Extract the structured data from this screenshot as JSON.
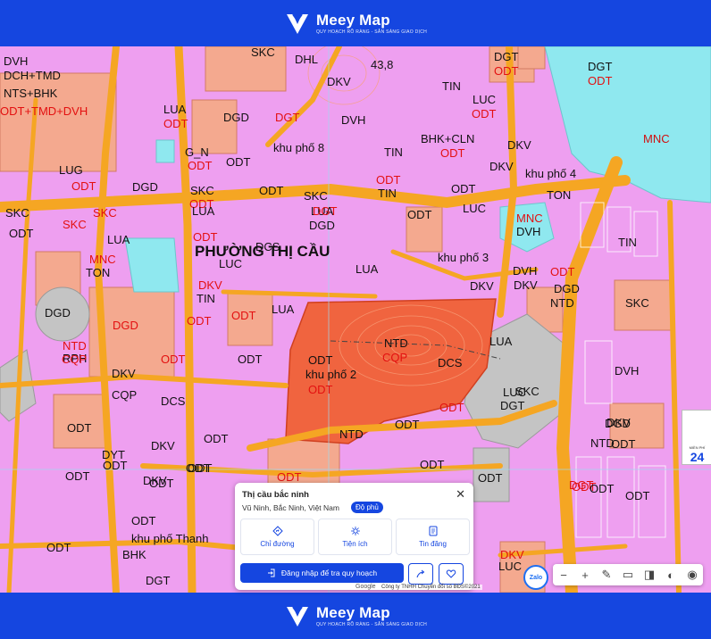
{
  "brand": {
    "name": "Meey Map",
    "tagline": "QUY HOẠCH RÕ RÀNG - SẴN SÀNG GIAO DỊCH"
  },
  "colors": {
    "brand": "#1546e0",
    "residential": "#ee9ff0",
    "road": "#f5a623",
    "rph_area": "#f0643f",
    "water": "#8fe8ef",
    "public": "#f4a98f",
    "grey": "#bdbdbd"
  },
  "map": {
    "labels": [
      {
        "text": "SKC",
        "c": "k"
      },
      {
        "text": "DHL",
        "c": "k"
      },
      {
        "text": "43,8",
        "c": "k"
      },
      {
        "text": "DGT",
        "c": "k"
      },
      {
        "text": "ODT",
        "c": "r"
      },
      {
        "text": "DGT",
        "c": "k"
      },
      {
        "text": "ODT",
        "c": "r"
      },
      {
        "text": "DVH",
        "c": "k"
      },
      {
        "text": "DCH+TMD",
        "c": "k"
      },
      {
        "text": "NTS+BHK",
        "c": "k"
      },
      {
        "text": "ODT+TMD+DVH",
        "c": "r"
      },
      {
        "text": "DKV",
        "c": "k"
      },
      {
        "text": "TIN",
        "c": "k"
      },
      {
        "text": "LUC",
        "c": "k"
      },
      {
        "text": "ODT",
        "c": "r"
      },
      {
        "text": "MNC",
        "c": "mnc"
      },
      {
        "text": "LUA",
        "c": "k"
      },
      {
        "text": "ODT",
        "c": "r"
      },
      {
        "text": "DGD",
        "c": "k"
      },
      {
        "text": "DGT",
        "c": "r"
      },
      {
        "text": "DVH",
        "c": "k"
      },
      {
        "text": "BHK+CLN",
        "c": "k"
      },
      {
        "text": "ODT",
        "c": "r"
      },
      {
        "text": "G_N",
        "c": "k"
      },
      {
        "text": "ODT",
        "c": "r"
      },
      {
        "text": "ODT",
        "c": "k"
      },
      {
        "text": "khu phố 8",
        "c": "k"
      },
      {
        "text": "TIN",
        "c": "k"
      },
      {
        "text": "DKV",
        "c": "k"
      },
      {
        "text": "LUG",
        "c": "k"
      },
      {
        "text": "ODT",
        "c": "r"
      },
      {
        "text": "DGD",
        "c": "k"
      },
      {
        "text": "SKC",
        "c": "k"
      },
      {
        "text": "ODT",
        "c": "r"
      },
      {
        "text": "ODT",
        "c": "k"
      },
      {
        "text": "SKC",
        "c": "k"
      },
      {
        "text": "LUA",
        "c": "k"
      },
      {
        "text": "ODT",
        "c": "r"
      },
      {
        "text": "TIN",
        "c": "k"
      },
      {
        "text": "DKV",
        "c": "k"
      },
      {
        "text": "khu phố 4",
        "c": "k"
      },
      {
        "text": "ODT",
        "c": "k"
      },
      {
        "text": "TON",
        "c": "k"
      },
      {
        "text": "SKC",
        "c": "k"
      },
      {
        "text": "SKC",
        "c": "r"
      },
      {
        "text": "SKC",
        "c": "r"
      },
      {
        "text": "LUA",
        "c": "k"
      },
      {
        "text": "DGT",
        "c": "r"
      },
      {
        "text": "DGD",
        "c": "k"
      },
      {
        "text": "ODT",
        "c": "k"
      },
      {
        "text": "LUC",
        "c": "k"
      },
      {
        "text": "MNC",
        "c": "r"
      },
      {
        "text": "DVH",
        "c": "k"
      },
      {
        "text": "TIN",
        "c": "k"
      },
      {
        "text": "ODT",
        "c": "k"
      },
      {
        "text": "LUA",
        "c": "k"
      },
      {
        "text": "ODT",
        "c": "r"
      },
      {
        "text": "PHƯỜNG THỊ CẦU",
        "c": "big"
      },
      {
        "text": "DCS",
        "c": "k"
      },
      {
        "text": "khu phố 3",
        "c": "k"
      },
      {
        "text": "LUA",
        "c": "k"
      },
      {
        "text": "MNC",
        "c": "r"
      },
      {
        "text": "TON",
        "c": "k"
      },
      {
        "text": "LUC",
        "c": "k"
      },
      {
        "text": "DVH",
        "c": "k"
      },
      {
        "text": "ODT",
        "c": "r"
      },
      {
        "text": "DKV",
        "c": "k"
      },
      {
        "text": "DGD",
        "c": "k"
      },
      {
        "text": "SKC",
        "c": "k"
      },
      {
        "text": "DKV",
        "c": "r"
      },
      {
        "text": "TIN",
        "c": "k"
      },
      {
        "text": "DKV",
        "c": "k"
      },
      {
        "text": "NTD",
        "c": "k"
      },
      {
        "text": "DGD",
        "c": "k"
      },
      {
        "text": "DGD",
        "c": "r"
      },
      {
        "text": "ODT",
        "c": "r"
      },
      {
        "text": "LUA",
        "c": "k"
      },
      {
        "text": "ODT",
        "c": "r"
      },
      {
        "text": "RPH",
        "c": "k"
      },
      {
        "text": "NTD",
        "c": "k"
      },
      {
        "text": "LUA",
        "c": "k"
      },
      {
        "text": "NTD",
        "c": "r"
      },
      {
        "text": "CQP",
        "c": "r"
      },
      {
        "text": "CQP",
        "c": "r"
      },
      {
        "text": "DCS",
        "c": "k"
      },
      {
        "text": "ODT",
        "c": "k"
      },
      {
        "text": "khu phố 2",
        "c": "k"
      },
      {
        "text": "ODT",
        "c": "r"
      },
      {
        "text": "ODT",
        "c": "k"
      },
      {
        "text": "DVH",
        "c": "k"
      },
      {
        "text": "DKV",
        "c": "k"
      },
      {
        "text": "CQP",
        "c": "k"
      },
      {
        "text": "ODT",
        "c": "r"
      },
      {
        "text": "LUC",
        "c": "k"
      },
      {
        "text": "SKC",
        "c": "k"
      },
      {
        "text": "DCS",
        "c": "k"
      },
      {
        "text": "ODT",
        "c": "r"
      },
      {
        "text": "DGT",
        "c": "k"
      },
      {
        "text": "DGD",
        "c": "k"
      },
      {
        "text": "ODT",
        "c": "k"
      },
      {
        "text": "ODT",
        "c": "k"
      },
      {
        "text": "DKV",
        "c": "k"
      },
      {
        "text": "ODT",
        "c": "k"
      },
      {
        "text": "ODT",
        "c": "k"
      },
      {
        "text": "ODT",
        "c": "k"
      },
      {
        "text": "ODT",
        "c": "k"
      },
      {
        "text": "ODT",
        "c": "r"
      },
      {
        "text": "DGT",
        "c": "r"
      },
      {
        "text": "DYT",
        "c": "k"
      },
      {
        "text": "ODT",
        "c": "r"
      },
      {
        "text": "ODT",
        "c": "k"
      },
      {
        "text": "NTD",
        "c": "k"
      },
      {
        "text": "ODT",
        "c": "k"
      },
      {
        "text": "ODT",
        "c": "k"
      },
      {
        "text": "ODT",
        "c": "k"
      },
      {
        "text": "DKV",
        "c": "k"
      },
      {
        "text": "ODT",
        "c": "k"
      },
      {
        "text": "ODT",
        "c": "k"
      },
      {
        "text": "ODT",
        "c": "k"
      },
      {
        "text": "ODT",
        "c": "k"
      },
      {
        "text": "ODT",
        "c": "k"
      },
      {
        "text": "khu phố Thanh",
        "c": "k"
      },
      {
        "text": "BHK",
        "c": "k"
      },
      {
        "text": "DKV",
        "c": "r"
      },
      {
        "text": "LUC",
        "c": "k"
      },
      {
        "text": "DGT",
        "c": "k"
      },
      {
        "text": "DKV",
        "c": "k"
      },
      {
        "text": "NTD",
        "c": "k"
      }
    ]
  },
  "popup": {
    "title": "Thị cầu bắc ninh",
    "address": "Vũ Ninh, Bắc Ninh, Việt Nam",
    "badge": "Độ phủ",
    "actions": [
      {
        "label": "Chỉ đường",
        "icon": "directions-icon"
      },
      {
        "label": "Tiện ích",
        "icon": "amenities-icon"
      },
      {
        "label": "Tin đăng",
        "icon": "listing-icon"
      }
    ],
    "login_label": "Đăng nhập để tra quy hoạch"
  },
  "zalo": "Zalo",
  "toolbar": [
    {
      "symbol": "−",
      "icon": "zoom-out-icon"
    },
    {
      "symbol": "+",
      "icon": "zoom-in-icon"
    },
    {
      "symbol": "✎",
      "icon": "draw-icon"
    },
    {
      "symbol": "▭",
      "icon": "layer-icon"
    },
    {
      "symbol": "◨",
      "icon": "split-icon"
    },
    {
      "symbol": "◐",
      "icon": "opacity-icon"
    },
    {
      "symbol": "◉",
      "icon": "locate-icon"
    }
  ],
  "attribution": {
    "google": "Google",
    "copyright": "Công ty TNHH Chuyển đổi số BĐS©2021"
  },
  "side_ad": {
    "small": "MIỀN PHÍ",
    "number": "24"
  }
}
